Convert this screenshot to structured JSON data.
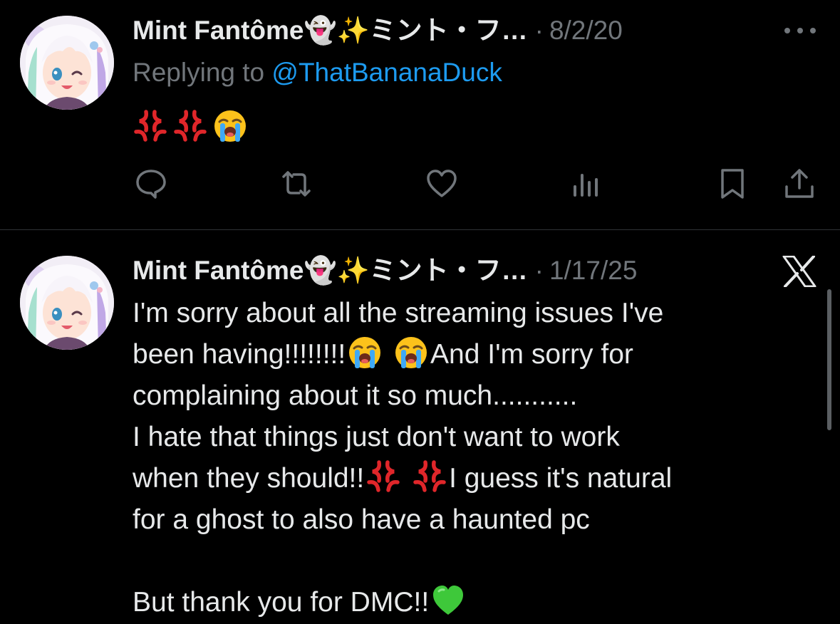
{
  "tweets": [
    {
      "author": "Mint Fantôme👻✨ミント・フ…",
      "separator": "·",
      "date": "8/2/20",
      "replying_prefix": "Replying to",
      "replying_handle": "@ThatBananaDuck",
      "emojis": [
        "anger-symbol",
        "anger-symbol",
        "loudly-crying-face"
      ],
      "actions": [
        "reply-icon",
        "retweet-icon",
        "like-icon",
        "views-icon",
        "bookmark-icon",
        "share-icon"
      ]
    },
    {
      "author": "Mint Fantôme👻✨ミント・フ…",
      "separator": "·",
      "date": "1/17/25",
      "line1": "I'm sorry about all the streaming issues I've",
      "line2_a": "been having!!!!!!!!",
      "line2_b": "And I'm sorry for",
      "line3": "complaining about it so much...........",
      "line4": "I hate that things just don't want to work",
      "line5_a": "when they should!!",
      "line5_b": "I guess it's natural",
      "line6": "for a ghost to also have a haunted pc",
      "line7": "But thank you for DMC!!"
    }
  ],
  "colors": {
    "background": "#000000",
    "text": "#e7e9ea",
    "secondary": "#71767b",
    "link": "#1d9bf0",
    "divider": "#2f3336"
  }
}
